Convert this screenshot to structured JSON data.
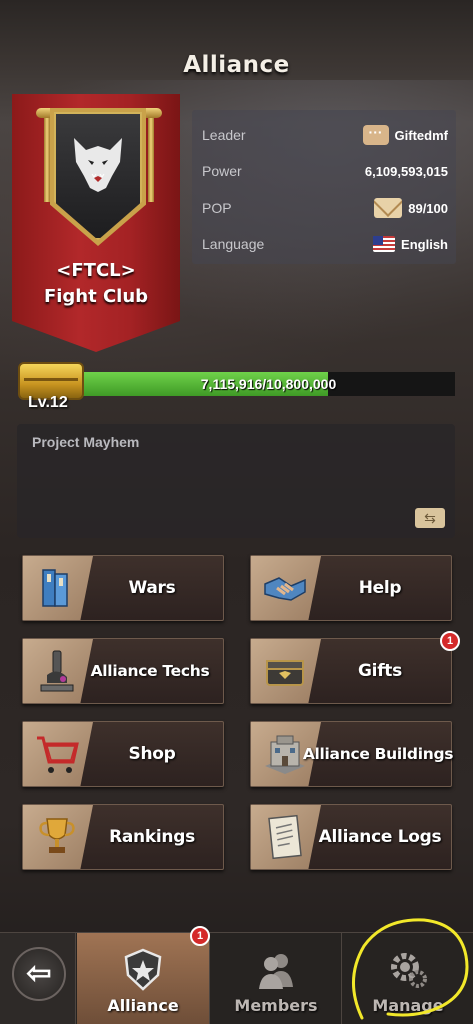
{
  "header": {
    "title": "Alliance"
  },
  "alliance": {
    "tag": "<FTCL>",
    "name": "Fight Club",
    "info": {
      "leader_label": "Leader",
      "leader_value": "Giftedmf",
      "power_label": "Power",
      "power_value": "6,109,593,015",
      "pop_label": "POP",
      "pop_value": "89/100",
      "language_label": "Language",
      "language_value": "English"
    },
    "level": "Lv.12",
    "progress": {
      "text": "7,115,916/10,800,000",
      "current": 7115916,
      "max": 10800000,
      "fraction": 0.659
    },
    "notice": "Project Mayhem"
  },
  "menu": {
    "wars": "Wars",
    "help": "Help",
    "techs": "Alliance Techs",
    "gifts": "Gifts",
    "gifts_badge": "1",
    "shop": "Shop",
    "buildings": "Alliance Buildings",
    "rankings": "Rankings",
    "logs": "Alliance Logs"
  },
  "nav": {
    "alliance": "Alliance",
    "alliance_badge": "1",
    "members": "Members",
    "manage": "Manage"
  },
  "colors": {
    "banner": "#a42224",
    "progress_fill": "#4fb22f",
    "badge": "#d42a2a",
    "active_tab": "#8a6246",
    "annotation": "#f2e82a"
  },
  "icons": [
    "wolf-emblem-icon",
    "chat-icon",
    "mail-icon",
    "us-flag-icon",
    "chest-icon",
    "swap-icon",
    "books-icon",
    "handshake-icon",
    "microscope-icon",
    "gift-chest-icon",
    "shopping-cart-icon",
    "building-icon",
    "trophy-icon",
    "log-document-icon",
    "back-arrow-icon",
    "alliance-shield-icon",
    "members-icon",
    "gear-icon"
  ]
}
